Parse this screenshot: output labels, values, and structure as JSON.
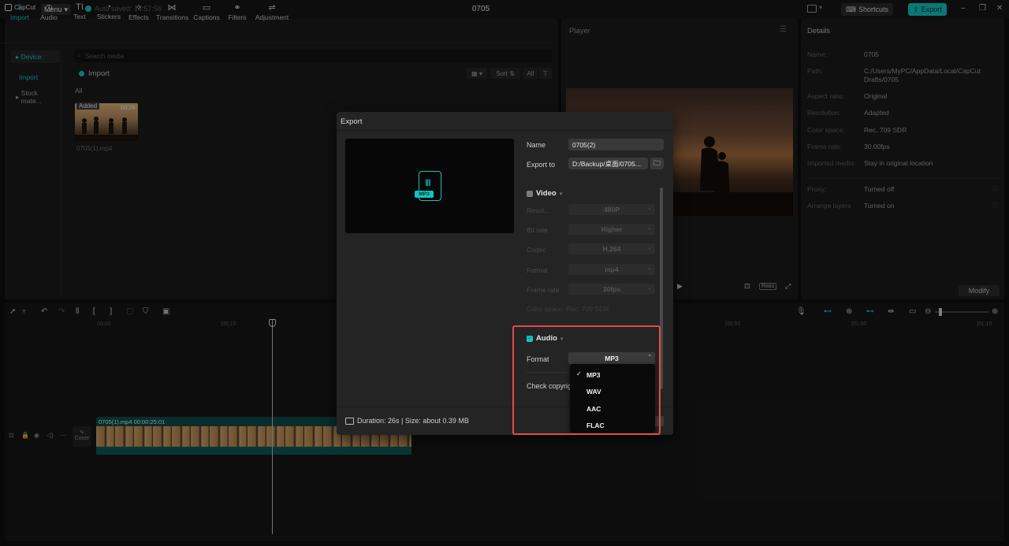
{
  "app": {
    "logo": "CapCut",
    "menu_label": "Menu",
    "autosave": "Auto saved: 14:57:56",
    "title": "0705",
    "shortcuts_label": "Shortcuts",
    "export_label": "Export",
    "accent_color": "#13c2c2"
  },
  "media": {
    "tabs": [
      "Import",
      "Audio",
      "Text",
      "Stickers",
      "Effects",
      "Transitions",
      "Captions",
      "Filters",
      "Adjustment"
    ],
    "sidebar": [
      "Device",
      "Import",
      "Stock mate..."
    ],
    "search_placeholder": "Search media",
    "import_label": "Import",
    "sort_label": "Sort",
    "all_filter": "All",
    "all_label": "All",
    "clip": {
      "badge": "Added",
      "duration": "00:26",
      "name": "0705(1).mp4"
    }
  },
  "player": {
    "title": "Player",
    "ratio_label": "Ratio"
  },
  "details": {
    "title": "Details",
    "rows": [
      {
        "label": "Name:",
        "value": "0705"
      },
      {
        "label": "Path:",
        "value": "C:/Users/MyPC/AppData/Local/CapCut Drafts/0705"
      },
      {
        "label": "Aspect ratio:",
        "value": "Original"
      },
      {
        "label": "Resolution:",
        "value": "Adapted"
      },
      {
        "label": "Color space:",
        "value": "Rec. 709 SDR"
      },
      {
        "label": "Frame rate:",
        "value": "30.00fps"
      },
      {
        "label": "Imported media:",
        "value": "Stay in original location"
      },
      {
        "label": "Proxy:",
        "value": "Turned off"
      },
      {
        "label": "Arrange layers",
        "value": "Turned on"
      }
    ],
    "modify_label": "Modify"
  },
  "timeline": {
    "ruler": [
      "00:00",
      "|00:10",
      "|00:50",
      "|01:00",
      "|01:10"
    ],
    "clip_label": "0705(1).mp4   00:00:25:01",
    "cover_label": "Cover"
  },
  "export": {
    "title": "Export",
    "name_label": "Name",
    "name_value": "0705(2)",
    "export_to_label": "Export to",
    "export_to_value": "D:/Backup/桌面/0705...",
    "video_label": "Video",
    "video_settings": [
      {
        "label": "Resol...",
        "value": "480P"
      },
      {
        "label": "Bit rate",
        "value": "Higher"
      },
      {
        "label": "Codec",
        "value": "H.264"
      },
      {
        "label": "Format",
        "value": "mp4"
      },
      {
        "label": "Frame rate",
        "value": "30fps"
      }
    ],
    "color_space": "Color space: Rec. 709 SDR",
    "audio_label": "Audio",
    "audio_format_label": "Format",
    "audio_format_value": "MP3",
    "check_copyright": "Check copyrigh",
    "file_tag": "MP3",
    "footer_info": "Duration: 26s | Size: about 0.39 MB",
    "format_options": [
      "MP3",
      "WAV",
      "AAC",
      "FLAC"
    ],
    "selected_option": "MP3",
    "highlight_color": "#e24a4a"
  }
}
